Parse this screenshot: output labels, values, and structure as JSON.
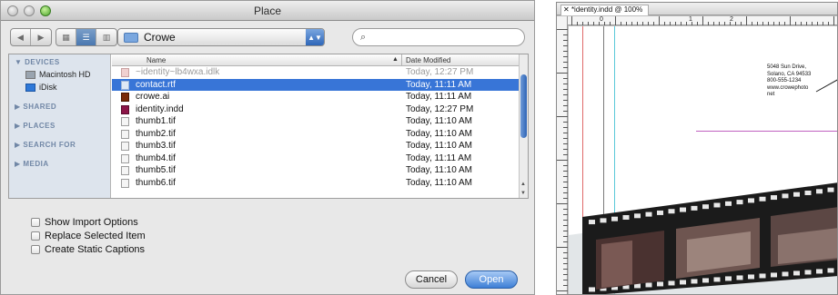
{
  "dialog": {
    "title": "Place",
    "folder_popup": "Crowe",
    "search_placeholder": "",
    "sidebar": {
      "devices_header": "▼ DEVICES",
      "devices": [
        "Macintosh HD",
        "iDisk"
      ],
      "shared_header": "▶ SHARED",
      "places_header": "▶ PLACES",
      "search_header": "▶ SEARCH FOR",
      "media_header": "▶ MEDIA"
    },
    "columns": {
      "name": "Name",
      "date": "Date Modified"
    },
    "files": [
      {
        "name": "~identity~lb4wxa.idlk",
        "date": "Today, 12:27 PM",
        "icon": "lock-file-icon",
        "state": "dim"
      },
      {
        "name": "contact.rtf",
        "date": "Today, 11:11 AM",
        "icon": "document-icon",
        "state": "selected"
      },
      {
        "name": "crowe.ai",
        "date": "Today, 11:11 AM",
        "icon": "illustrator-icon",
        "state": "normal"
      },
      {
        "name": "identity.indd",
        "date": "Today, 12:27 PM",
        "icon": "indesign-icon",
        "state": "normal"
      },
      {
        "name": "thumb1.tif",
        "date": "Today, 11:10 AM",
        "icon": "document-icon",
        "state": "normal"
      },
      {
        "name": "thumb2.tif",
        "date": "Today, 11:10 AM",
        "icon": "document-icon",
        "state": "normal"
      },
      {
        "name": "thumb3.tif",
        "date": "Today, 11:10 AM",
        "icon": "document-icon",
        "state": "normal"
      },
      {
        "name": "thumb4.tif",
        "date": "Today, 11:11 AM",
        "icon": "document-icon",
        "state": "normal"
      },
      {
        "name": "thumb5.tif",
        "date": "Today, 11:10 AM",
        "icon": "document-icon",
        "state": "normal"
      },
      {
        "name": "thumb6.tif",
        "date": "Today, 11:10 AM",
        "icon": "document-icon",
        "state": "normal"
      }
    ],
    "options": [
      "Show Import Options",
      "Replace Selected Item",
      "Create Static Captions"
    ],
    "cancel_label": "Cancel",
    "open_label": "Open",
    "selection_color": "#3875d7"
  },
  "document": {
    "tab_title": "*identity.indd @ 100%",
    "ruler_numbers": [
      "0",
      "1",
      "2"
    ],
    "address_lines": [
      "5048 Sun Drive,",
      "Solano, CA 94533",
      "800-555-1234",
      "www.crowephoto",
      "net"
    ]
  }
}
